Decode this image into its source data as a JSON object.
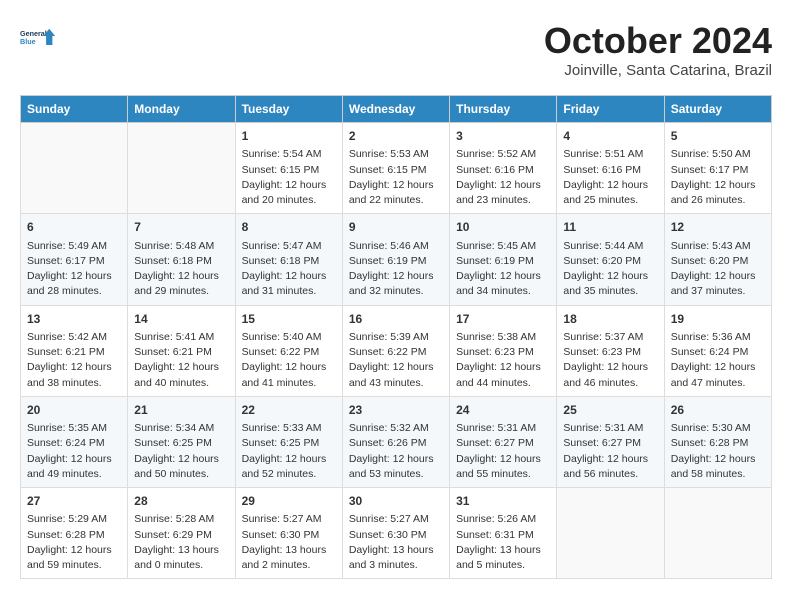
{
  "header": {
    "logo_general": "General",
    "logo_blue": "Blue",
    "month": "October 2024",
    "location": "Joinville, Santa Catarina, Brazil"
  },
  "weekdays": [
    "Sunday",
    "Monday",
    "Tuesday",
    "Wednesday",
    "Thursday",
    "Friday",
    "Saturday"
  ],
  "weeks": [
    [
      {
        "day": "",
        "sunrise": "",
        "sunset": "",
        "daylight": ""
      },
      {
        "day": "",
        "sunrise": "",
        "sunset": "",
        "daylight": ""
      },
      {
        "day": "1",
        "sunrise": "Sunrise: 5:54 AM",
        "sunset": "Sunset: 6:15 PM",
        "daylight": "Daylight: 12 hours and 20 minutes."
      },
      {
        "day": "2",
        "sunrise": "Sunrise: 5:53 AM",
        "sunset": "Sunset: 6:15 PM",
        "daylight": "Daylight: 12 hours and 22 minutes."
      },
      {
        "day": "3",
        "sunrise": "Sunrise: 5:52 AM",
        "sunset": "Sunset: 6:16 PM",
        "daylight": "Daylight: 12 hours and 23 minutes."
      },
      {
        "day": "4",
        "sunrise": "Sunrise: 5:51 AM",
        "sunset": "Sunset: 6:16 PM",
        "daylight": "Daylight: 12 hours and 25 minutes."
      },
      {
        "day": "5",
        "sunrise": "Sunrise: 5:50 AM",
        "sunset": "Sunset: 6:17 PM",
        "daylight": "Daylight: 12 hours and 26 minutes."
      }
    ],
    [
      {
        "day": "6",
        "sunrise": "Sunrise: 5:49 AM",
        "sunset": "Sunset: 6:17 PM",
        "daylight": "Daylight: 12 hours and 28 minutes."
      },
      {
        "day": "7",
        "sunrise": "Sunrise: 5:48 AM",
        "sunset": "Sunset: 6:18 PM",
        "daylight": "Daylight: 12 hours and 29 minutes."
      },
      {
        "day": "8",
        "sunrise": "Sunrise: 5:47 AM",
        "sunset": "Sunset: 6:18 PM",
        "daylight": "Daylight: 12 hours and 31 minutes."
      },
      {
        "day": "9",
        "sunrise": "Sunrise: 5:46 AM",
        "sunset": "Sunset: 6:19 PM",
        "daylight": "Daylight: 12 hours and 32 minutes."
      },
      {
        "day": "10",
        "sunrise": "Sunrise: 5:45 AM",
        "sunset": "Sunset: 6:19 PM",
        "daylight": "Daylight: 12 hours and 34 minutes."
      },
      {
        "day": "11",
        "sunrise": "Sunrise: 5:44 AM",
        "sunset": "Sunset: 6:20 PM",
        "daylight": "Daylight: 12 hours and 35 minutes."
      },
      {
        "day": "12",
        "sunrise": "Sunrise: 5:43 AM",
        "sunset": "Sunset: 6:20 PM",
        "daylight": "Daylight: 12 hours and 37 minutes."
      }
    ],
    [
      {
        "day": "13",
        "sunrise": "Sunrise: 5:42 AM",
        "sunset": "Sunset: 6:21 PM",
        "daylight": "Daylight: 12 hours and 38 minutes."
      },
      {
        "day": "14",
        "sunrise": "Sunrise: 5:41 AM",
        "sunset": "Sunset: 6:21 PM",
        "daylight": "Daylight: 12 hours and 40 minutes."
      },
      {
        "day": "15",
        "sunrise": "Sunrise: 5:40 AM",
        "sunset": "Sunset: 6:22 PM",
        "daylight": "Daylight: 12 hours and 41 minutes."
      },
      {
        "day": "16",
        "sunrise": "Sunrise: 5:39 AM",
        "sunset": "Sunset: 6:22 PM",
        "daylight": "Daylight: 12 hours and 43 minutes."
      },
      {
        "day": "17",
        "sunrise": "Sunrise: 5:38 AM",
        "sunset": "Sunset: 6:23 PM",
        "daylight": "Daylight: 12 hours and 44 minutes."
      },
      {
        "day": "18",
        "sunrise": "Sunrise: 5:37 AM",
        "sunset": "Sunset: 6:23 PM",
        "daylight": "Daylight: 12 hours and 46 minutes."
      },
      {
        "day": "19",
        "sunrise": "Sunrise: 5:36 AM",
        "sunset": "Sunset: 6:24 PM",
        "daylight": "Daylight: 12 hours and 47 minutes."
      }
    ],
    [
      {
        "day": "20",
        "sunrise": "Sunrise: 5:35 AM",
        "sunset": "Sunset: 6:24 PM",
        "daylight": "Daylight: 12 hours and 49 minutes."
      },
      {
        "day": "21",
        "sunrise": "Sunrise: 5:34 AM",
        "sunset": "Sunset: 6:25 PM",
        "daylight": "Daylight: 12 hours and 50 minutes."
      },
      {
        "day": "22",
        "sunrise": "Sunrise: 5:33 AM",
        "sunset": "Sunset: 6:25 PM",
        "daylight": "Daylight: 12 hours and 52 minutes."
      },
      {
        "day": "23",
        "sunrise": "Sunrise: 5:32 AM",
        "sunset": "Sunset: 6:26 PM",
        "daylight": "Daylight: 12 hours and 53 minutes."
      },
      {
        "day": "24",
        "sunrise": "Sunrise: 5:31 AM",
        "sunset": "Sunset: 6:27 PM",
        "daylight": "Daylight: 12 hours and 55 minutes."
      },
      {
        "day": "25",
        "sunrise": "Sunrise: 5:31 AM",
        "sunset": "Sunset: 6:27 PM",
        "daylight": "Daylight: 12 hours and 56 minutes."
      },
      {
        "day": "26",
        "sunrise": "Sunrise: 5:30 AM",
        "sunset": "Sunset: 6:28 PM",
        "daylight": "Daylight: 12 hours and 58 minutes."
      }
    ],
    [
      {
        "day": "27",
        "sunrise": "Sunrise: 5:29 AM",
        "sunset": "Sunset: 6:28 PM",
        "daylight": "Daylight: 12 hours and 59 minutes."
      },
      {
        "day": "28",
        "sunrise": "Sunrise: 5:28 AM",
        "sunset": "Sunset: 6:29 PM",
        "daylight": "Daylight: 13 hours and 0 minutes."
      },
      {
        "day": "29",
        "sunrise": "Sunrise: 5:27 AM",
        "sunset": "Sunset: 6:30 PM",
        "daylight": "Daylight: 13 hours and 2 minutes."
      },
      {
        "day": "30",
        "sunrise": "Sunrise: 5:27 AM",
        "sunset": "Sunset: 6:30 PM",
        "daylight": "Daylight: 13 hours and 3 minutes."
      },
      {
        "day": "31",
        "sunrise": "Sunrise: 5:26 AM",
        "sunset": "Sunset: 6:31 PM",
        "daylight": "Daylight: 13 hours and 5 minutes."
      },
      {
        "day": "",
        "sunrise": "",
        "sunset": "",
        "daylight": ""
      },
      {
        "day": "",
        "sunrise": "",
        "sunset": "",
        "daylight": ""
      }
    ]
  ]
}
